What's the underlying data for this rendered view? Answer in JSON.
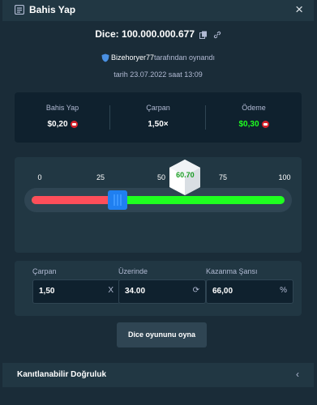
{
  "header": {
    "title": "Bahis Yap",
    "close_icon": "close-icon",
    "title_icon": "betslip-icon"
  },
  "bet": {
    "dice_id": "Dice: 100.000.000.677",
    "played_by_user": "Bizehoryer77",
    "played_by_suffix": "tarafından oynandı",
    "date": "tarih 23.07.2022 saat 13:09"
  },
  "stats": [
    {
      "label": "Bahis Yap",
      "value": "$0,20",
      "coin": true
    },
    {
      "label": "Çarpan",
      "value": "1,50×",
      "coin": false
    },
    {
      "label": "Ödeme",
      "value": "$0,30",
      "coin": true,
      "color": "#1fff20"
    }
  ],
  "slider": {
    "ticks": [
      "0",
      "25",
      "50",
      "75",
      "100"
    ],
    "roll_over": 34,
    "result": "60.70",
    "result_value": 60.7,
    "lose_color": "#ff4e5a",
    "win_color": "#1fff20"
  },
  "fields": [
    {
      "label": "Çarpan",
      "value": "1,50",
      "suffix": "X"
    },
    {
      "label": "Üzerinde",
      "value": "34.00",
      "suffix": "⟳"
    },
    {
      "label": "Kazanma Şansı",
      "value": "66,00",
      "suffix": "%"
    }
  ],
  "action_button": "Dice oyununu oyna",
  "fairness": {
    "label": "Kanıtlanabilir Doğruluk"
  },
  "colors": {
    "background": "#1a2c38",
    "panel": "#213743",
    "dark": "#0f212e",
    "accent": "#1f7ff0"
  }
}
